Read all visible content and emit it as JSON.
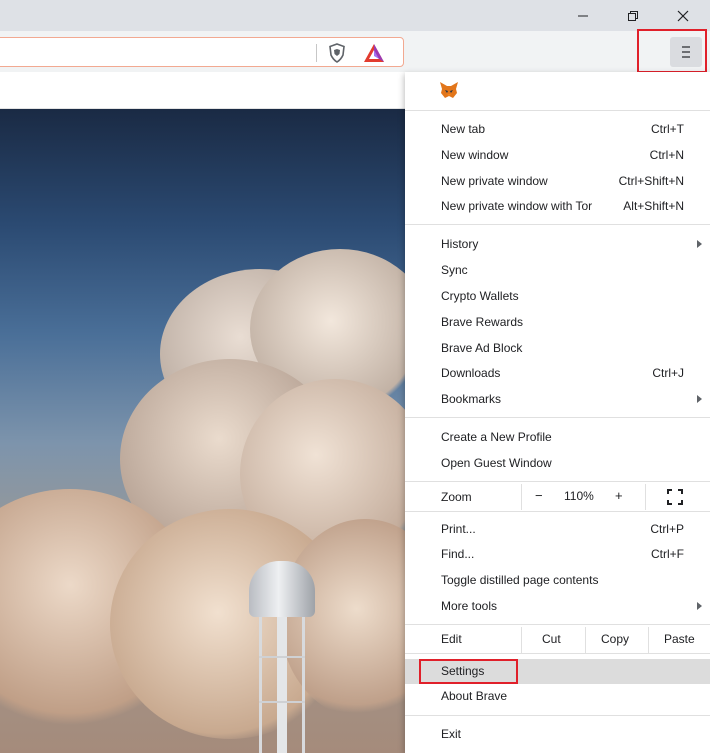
{
  "window": {
    "minimize_icon": "minimize-icon",
    "restore_icon": "restore-icon",
    "close_icon": "close-icon"
  },
  "toolbar": {
    "shield_icon": "brave-shields-icon",
    "rewards_icon": "brave-rewards-icon",
    "menu_icon": "hamburger-menu-icon"
  },
  "colors": {
    "highlight": "#e0202a",
    "selected_row": "#dcdcdc",
    "addressbar_border": "#f2a991"
  },
  "menu": {
    "extension_icon": "metamask-fox-icon",
    "group1": [
      {
        "label": "New tab",
        "shortcut": "Ctrl+T"
      },
      {
        "label": "New window",
        "shortcut": "Ctrl+N"
      },
      {
        "label": "New private window",
        "shortcut": "Ctrl+Shift+N"
      },
      {
        "label": "New private window with Tor",
        "shortcut": "Alt+Shift+N"
      }
    ],
    "group2": [
      {
        "label": "History",
        "shortcut": "",
        "submenu": true
      },
      {
        "label": "Sync",
        "shortcut": ""
      },
      {
        "label": "Crypto Wallets",
        "shortcut": ""
      },
      {
        "label": "Brave Rewards",
        "shortcut": ""
      },
      {
        "label": "Brave Ad Block",
        "shortcut": ""
      },
      {
        "label": "Downloads",
        "shortcut": "Ctrl+J"
      },
      {
        "label": "Bookmarks",
        "shortcut": "",
        "submenu": true
      }
    ],
    "group3": [
      {
        "label": "Create a New Profile"
      },
      {
        "label": "Open Guest Window"
      }
    ],
    "zoom": {
      "label": "Zoom",
      "minus": "−",
      "value": "110%",
      "plus": "+"
    },
    "group4": [
      {
        "label": "Print...",
        "shortcut": "Ctrl+P"
      },
      {
        "label": "Find...",
        "shortcut": "Ctrl+F"
      },
      {
        "label": "Toggle distilled page contents",
        "shortcut": ""
      },
      {
        "label": "More tools",
        "shortcut": "",
        "submenu": true
      }
    ],
    "edit": {
      "label": "Edit",
      "cut": "Cut",
      "copy": "Copy",
      "paste": "Paste"
    },
    "group5": [
      {
        "label": "Settings"
      },
      {
        "label": "About Brave"
      }
    ],
    "exit": {
      "label": "Exit"
    }
  }
}
